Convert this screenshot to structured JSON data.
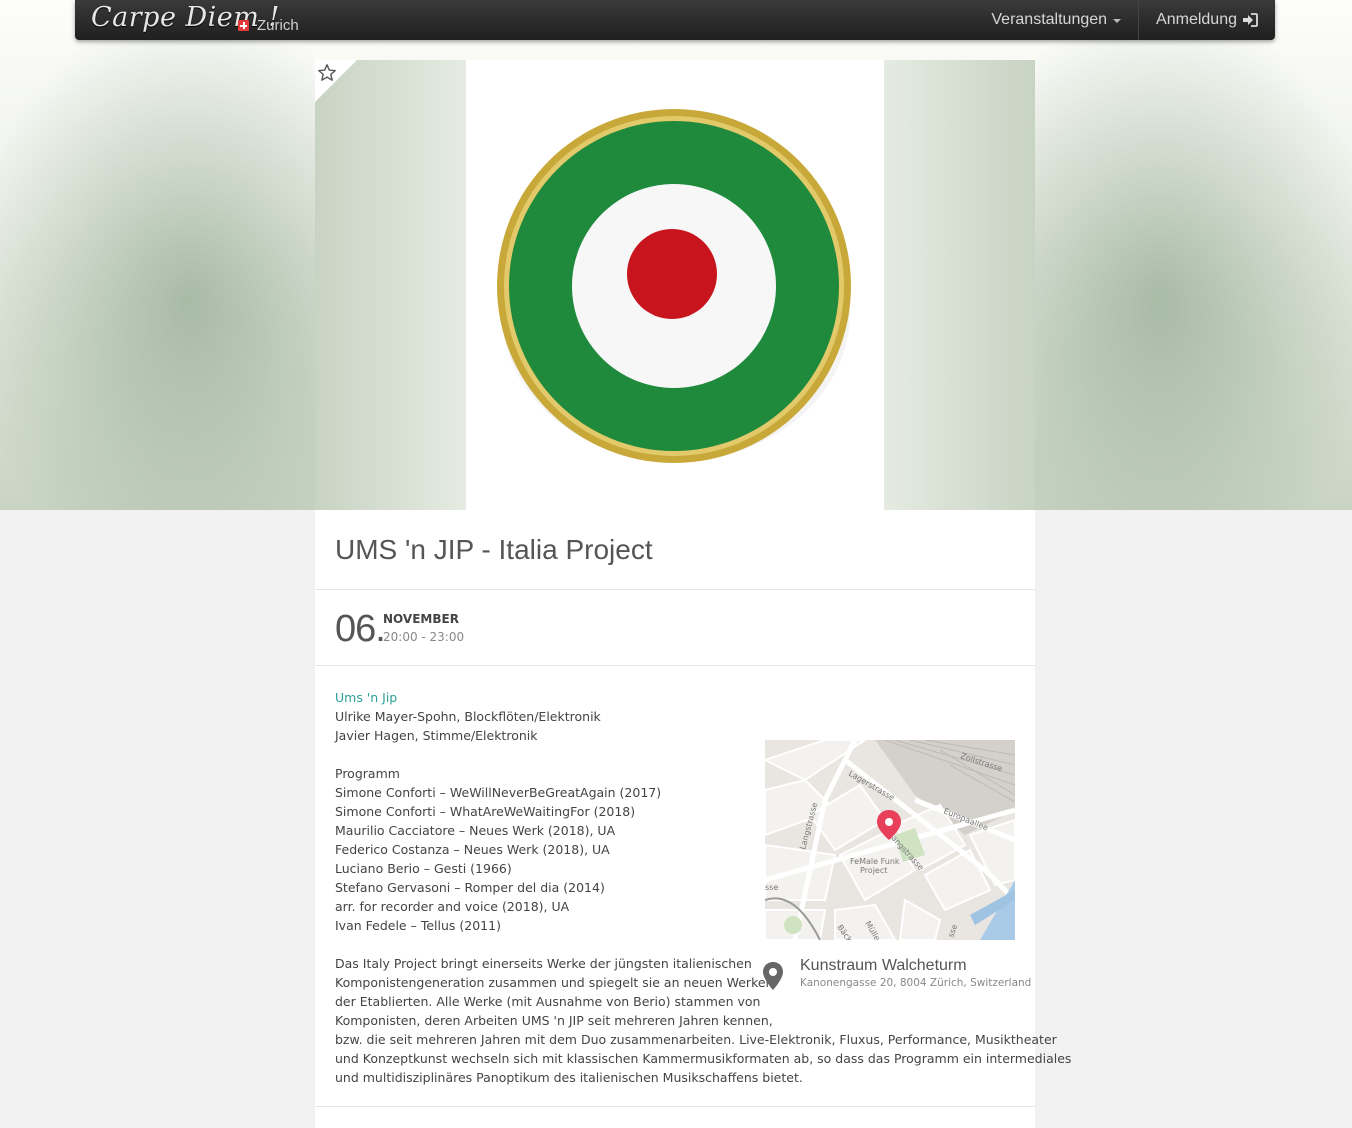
{
  "navbar": {
    "brand": "Carpe Diem !",
    "city": "Zurich",
    "menu_events": "Veranstaltungen",
    "menu_login": "Anmeldung"
  },
  "event": {
    "title": "UMS 'n JIP - Italia Project",
    "day": "06.",
    "month": "NOVEMBER",
    "time": "20:00 - 23:00",
    "performers_link": "Ums 'n Jip",
    "performers": [
      "Ulrike Mayer-Spohn, Blockflöten/Elektronik",
      "Javier Hagen, Stimme/Elektronik"
    ],
    "program_heading": "Programm",
    "program": [
      "Simone Conforti – WeWillNeverBeGreatAgain (2017)",
      "Simone Conforti – WhatAreWeWaitingFor (2018)",
      "Maurilio Cacciatore – Neues Werk (2018), UA",
      "Federico Costanza – Neues Werk (2018), UA",
      "Luciano Berio – Gesti (1966)",
      "Stefano Gervasoni – Romper del dia (2014)",
      "arr. for recorder and voice (2018), UA",
      "Ivan Fedele – Tellus (2011)"
    ],
    "description_lines": [
      "Das Italy Project bringt einerseits Werke der jüngsten italienischen",
      "Komponistengeneration zusammen und spiegelt sie an neuen Werken",
      "der Etablierten. Alle Werke (mit Ausnahme von Berio) stammen von",
      "Komponisten, deren Arbeiten UMS 'n JIP seit mehreren Jahren kennen,",
      "bzw. die seit mehreren Jahren mit dem Duo zusammenarbeiten. Live-Elektronik, Fluxus, Performance, Musiktheater",
      "und Konzeptkunst wechseln sich mit klassischen Kammermusikformaten ab, so dass das Programm ein intermediales",
      "und multidisziplinäres Panoptikum des italienischen Musikschaffens bietet."
    ]
  },
  "map": {
    "streets": {
      "zollstrasse": "Zollstrasse",
      "lagerstrasse": "Lagerstrasse",
      "langstrasse": "Langstrasse",
      "europaallee": "Europaallee",
      "poi_line1": "FeMale Funk",
      "poi_line2": "Project",
      "langstrasse2": "Langstrasse",
      "baecker": "Bäcker",
      "mueller": "Müller",
      "edge_left": "sse",
      "edge_right": "sse"
    },
    "marker_color": "#e8405a"
  },
  "venue": {
    "name": "Kunstraum Walcheturm",
    "address": "Kanonengasse 20, 8004 Zürich, Switzerland"
  },
  "colors": {
    "accent_link": "#2aa198",
    "roundel_green": "#1f8a3c",
    "roundel_red": "#c8141c",
    "roundel_gold": "#c9a83a"
  }
}
